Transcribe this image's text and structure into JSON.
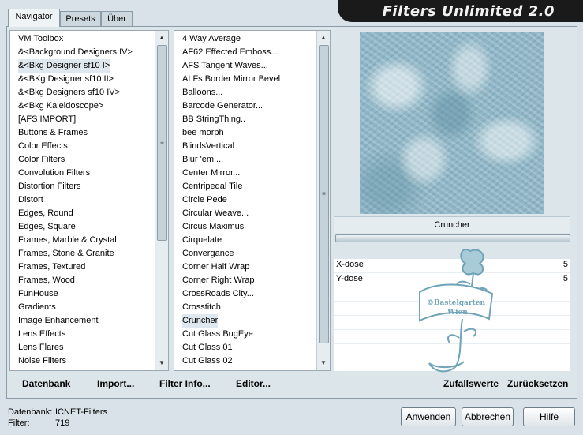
{
  "app_title": "Filters Unlimited 2.0",
  "tabs": [
    "Navigator",
    "Presets",
    "Über"
  ],
  "categories": {
    "items": [
      "VM Toolbox",
      "&<Background Designers IV>",
      "&<Bkg Designer sf10 I>",
      "&<BKg Designer sf10 II>",
      "&<Bkg Designers sf10 IV>",
      "&<Bkg Kaleidoscope>",
      "[AFS IMPORT]",
      "Buttons & Frames",
      "Color Effects",
      "Color Filters",
      "Convolution Filters",
      "Distortion Filters",
      "Distort",
      "Edges, Round",
      "Edges, Square",
      "Frames, Marble & Crystal",
      "Frames, Stone & Granite",
      "Frames, Textured",
      "Frames, Wood",
      "FunHouse",
      "Gradients",
      "Image Enhancement",
      "Lens Effects",
      "Lens Flares",
      "Noise Filters"
    ],
    "selected_index": 2
  },
  "filters": {
    "items": [
      "4 Way Average",
      "AF62 Effected Emboss...",
      "AFS Tangent Waves...",
      "ALFs Border Mirror Bevel",
      "Balloons...",
      "Barcode Generator...",
      "BB StringThing..",
      "bee morph",
      "BlindsVertical",
      "Blur 'em!...",
      "Center Mirror...",
      "Centripedal Tile",
      "Circle Pede",
      "Circular Weave...",
      "Circus Maximus",
      "Cirquelate",
      "Convergance",
      "Corner Half Wrap",
      "Corner Right Wrap",
      "CrossRoads City...",
      "Crosstitch",
      "Cruncher",
      "Cut Glass  BugEye",
      "Cut Glass 01",
      "Cut Glass 02"
    ],
    "selected_index": 21
  },
  "preview": {
    "filter_name": "Cruncher",
    "params": [
      {
        "label": "X-dose",
        "value": "5"
      },
      {
        "label": "Y-dose",
        "value": "5"
      }
    ],
    "watermark_line1": "©Bastelgarten",
    "watermark_line2": "Wien"
  },
  "bottom_links": {
    "database": "Datenbank",
    "import": "Import...",
    "filter_info": "Filter Info...",
    "editor": "Editor...",
    "random": "Zufallswerte",
    "reset": "Zurücksetzen"
  },
  "status": {
    "database_label": "Datenbank:",
    "database_value": "ICNET-Filters",
    "filter_label": "Filter:",
    "filter_value": "719"
  },
  "buttons": {
    "apply": "Anwenden",
    "cancel": "Abbrechen",
    "help": "Hilfe"
  },
  "colors": {
    "background": "#d8e2e8",
    "title_bar": "#1a1a1a",
    "preview": "#8fb6c6",
    "watermark": "#6fa3b8"
  }
}
